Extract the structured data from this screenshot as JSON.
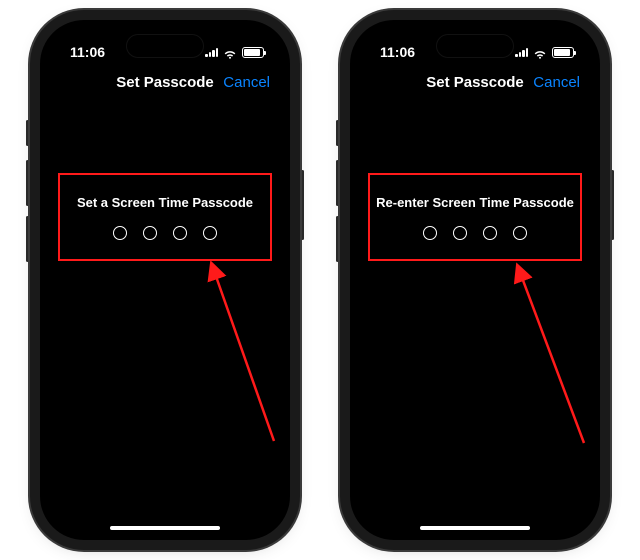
{
  "colors": {
    "accent": "#0a84ff",
    "highlight": "#ff1a1a"
  },
  "phones": [
    {
      "status": {
        "time": "11:06"
      },
      "nav": {
        "title": "Set Passcode",
        "cancel": "Cancel"
      },
      "passcode": {
        "heading": "Set a Screen Time Passcode",
        "length": 4
      }
    },
    {
      "status": {
        "time": "11:06"
      },
      "nav": {
        "title": "Set Passcode",
        "cancel": "Cancel"
      },
      "passcode": {
        "heading": "Re-enter Screen Time Passcode",
        "length": 4
      }
    }
  ]
}
